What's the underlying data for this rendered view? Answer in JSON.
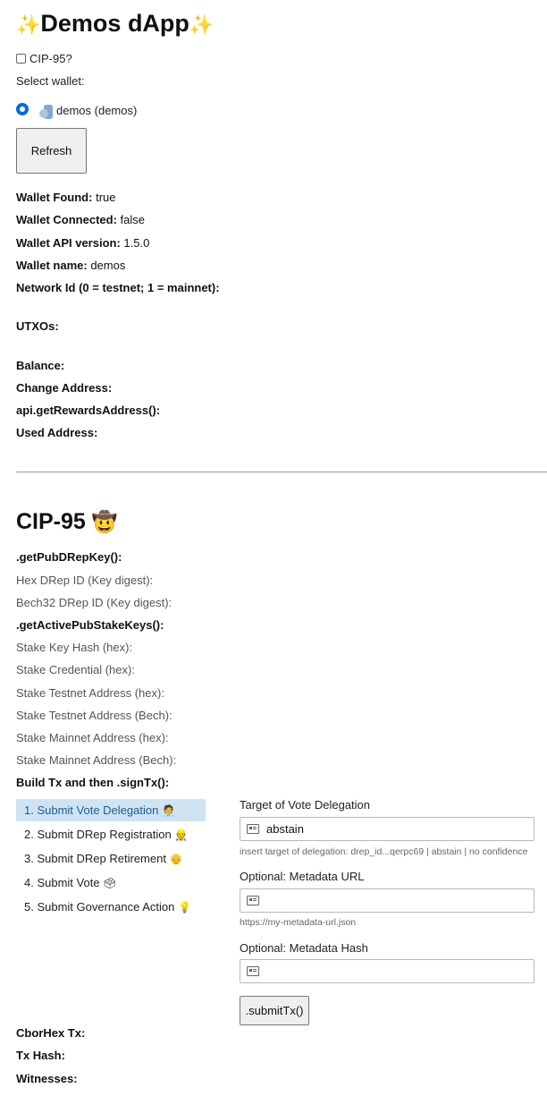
{
  "header": {
    "title": "Demos dApp",
    "spark_left": "✨",
    "spark_right": "✨"
  },
  "cip95_toggle": {
    "label": "CIP-95?",
    "checked": false
  },
  "wallet_select": {
    "label": "Select wallet:",
    "options": [
      {
        "label": "demos (demos)",
        "selected": true
      }
    ]
  },
  "refresh_button": "Refresh",
  "wallet_info": {
    "found": {
      "label": "Wallet Found:",
      "value": "true"
    },
    "connected": {
      "label": "Wallet Connected:",
      "value": "false"
    },
    "api_version": {
      "label": "Wallet API version:",
      "value": "1.5.0"
    },
    "name": {
      "label": "Wallet name:",
      "value": "demos"
    },
    "network_id": {
      "label": "Network Id (0 = testnet; 1 = mainnet):",
      "value": ""
    },
    "utxos": {
      "label": "UTXOs:",
      "value": ""
    },
    "balance": {
      "label": "Balance:",
      "value": ""
    },
    "change_address": {
      "label": "Change Address:",
      "value": ""
    },
    "rewards_address": {
      "label": "api.getRewardsAddress():",
      "value": ""
    },
    "used_address": {
      "label": "Used Address:",
      "value": ""
    }
  },
  "cip95": {
    "heading": "CIP-95",
    "heading_emoji": "🤠",
    "pub_drep_key": {
      "label": ".getPubDRepKey():",
      "hex_drep_id": "Hex DRep ID (Key digest):",
      "bech32_drep_id": "Bech32 DRep ID (Key digest):"
    },
    "active_stake_keys": {
      "label": ".getActivePubStakeKeys():",
      "stake_key_hash": "Stake Key Hash (hex):",
      "stake_credential": "Stake Credential (hex):",
      "stake_testnet_hex": "Stake Testnet Address (hex):",
      "stake_testnet_bech": "Stake Testnet Address (Bech):",
      "stake_mainnet_hex": "Stake Mainnet Address (hex):",
      "stake_mainnet_bech": "Stake Mainnet Address (Bech):"
    },
    "build_tx_label": "Build Tx and then .signTx():",
    "menu": [
      {
        "label": "1. Submit Vote Delegation",
        "emoji": "🧑‍💼",
        "active": true
      },
      {
        "label": "2. Submit DRep Registration",
        "emoji": "👷",
        "active": false
      },
      {
        "label": "3. Submit DRep Retirement",
        "emoji": "👴",
        "active": false
      },
      {
        "label": "4. Submit Vote",
        "emoji": "🗳",
        "active": false
      },
      {
        "label": "5. Submit Governance Action",
        "emoji": "💡",
        "active": false
      }
    ],
    "form": {
      "target": {
        "label": "Target of Vote Delegation",
        "value": "abstain",
        "help": "insert target of delegation: drep_id...qerpc69 | abstain | no confidence"
      },
      "metadata_url": {
        "label": "Optional: Metadata URL",
        "value": "",
        "help": "https://my-metadata-url.json"
      },
      "metadata_hash": {
        "label": "Optional: Metadata Hash",
        "value": ""
      },
      "submit_button": ".submitTx()"
    },
    "results": {
      "cborhex": "CborHex Tx:",
      "tx_hash": "Tx Hash:",
      "witnesses": "Witnesses:"
    }
  },
  "colors": {
    "accent": "#0a6ad3",
    "active_menu_bg": "#cfe3f3",
    "active_menu_text": "#1a5f96"
  }
}
